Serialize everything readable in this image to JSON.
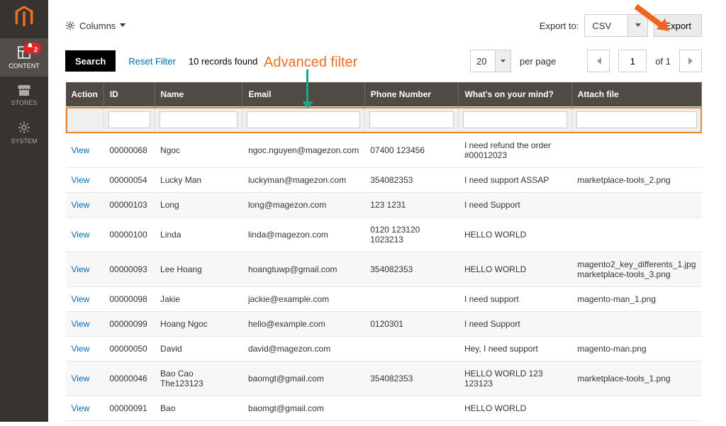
{
  "sidebar": {
    "items": [
      {
        "label": "CONTENT",
        "badge": "2"
      },
      {
        "label": "STORES"
      },
      {
        "label": "SYSTEM"
      }
    ]
  },
  "columns_btn": "Columns",
  "export": {
    "label": "Export to:",
    "format": "CSV",
    "button": "Export"
  },
  "toolbar": {
    "search": "Search",
    "reset": "Reset Filter",
    "records": "10 records found",
    "per_page_value": "20",
    "per_page_label": "per page",
    "page": "1",
    "page_total": "of 1"
  },
  "annot": "Advanced filter",
  "headers": {
    "action": "Action",
    "id": "ID",
    "name": "Name",
    "email": "Email",
    "phone": "Phone Number",
    "mind": "What's on your mind?",
    "attach": "Attach file"
  },
  "rows": [
    {
      "action": "View",
      "id": "00000068",
      "name": "Ngoc",
      "email": "ngoc.nguyen@magezon.com",
      "phone": "07400 123456",
      "mind": "I need refund the order #00012023",
      "attach": ""
    },
    {
      "action": "View",
      "id": "00000054",
      "name": "Lucky Man",
      "email": "luckyman@magezon.com",
      "phone": "354082353",
      "mind": "I need support ASSAP",
      "attach": "marketplace-tools_2.png"
    },
    {
      "action": "View",
      "id": "00000103",
      "name": "Long",
      "email": "long@magezon.com",
      "phone": "123 1231",
      "mind": "I need Support",
      "attach": ""
    },
    {
      "action": "View",
      "id": "00000100",
      "name": "Linda",
      "email": "linda@magezon.com",
      "phone": "0120 123120 1023213",
      "mind": "HELLO WORLD",
      "attach": ""
    },
    {
      "action": "View",
      "id": "00000093",
      "name": "Lee Hoang",
      "email": "hoangtuwp@gmail.com",
      "phone": "354082353",
      "mind": "HELLO WORLD",
      "attach": "magento2_key_differents_1.jpg marketplace-tools_3.png"
    },
    {
      "action": "View",
      "id": "00000098",
      "name": "Jakie",
      "email": "jackie@example.com",
      "phone": "",
      "mind": "I need support",
      "attach": "magento-man_1.png"
    },
    {
      "action": "View",
      "id": "00000099",
      "name": "Hoang Ngoc",
      "email": "hello@example.com",
      "phone": "0120301",
      "mind": "I need Support",
      "attach": ""
    },
    {
      "action": "View",
      "id": "00000050",
      "name": "David",
      "email": "david@magezon.com",
      "phone": "",
      "mind": "Hey, I need support",
      "attach": "magento-man.png"
    },
    {
      "action": "View",
      "id": "00000046",
      "name": "Bao Cao The123123",
      "email": "baomgt@gmail.com",
      "phone": "354082353",
      "mind": "HELLO WORLD 123 123123",
      "attach": "marketplace-tools_1.png"
    },
    {
      "action": "View",
      "id": "00000091",
      "name": "Bao",
      "email": "baomgt@gmail.com",
      "phone": "",
      "mind": "HELLO WORLD",
      "attach": ""
    }
  ]
}
